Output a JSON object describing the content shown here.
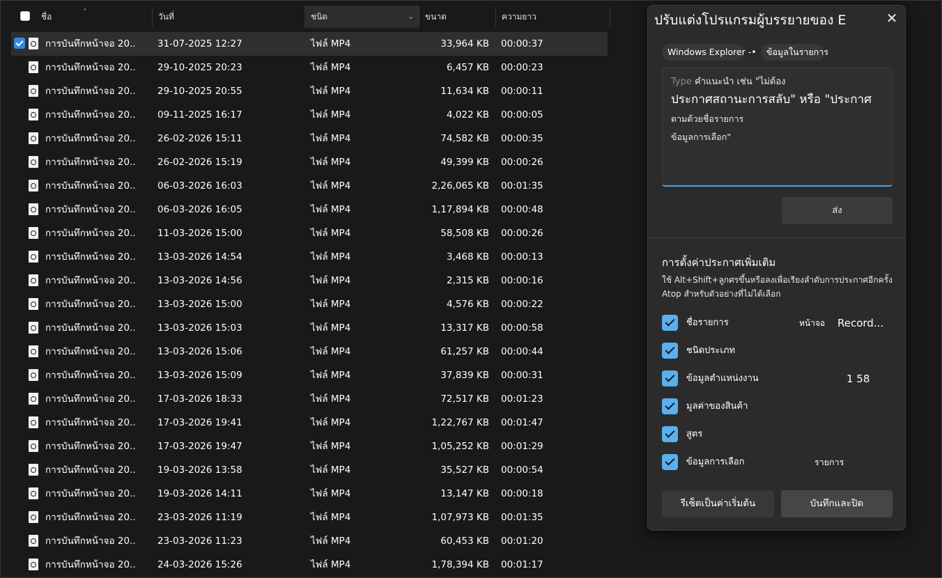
{
  "columns": {
    "name": "ชื่อ",
    "date": "วันที่",
    "type": "ชนิด",
    "size": "ขนาด",
    "length": "ความยาว"
  },
  "icons": {
    "sort_up": "sort-ascending-icon",
    "chevron": "chevron-down-icon",
    "file": "video-file-icon",
    "close": "close-icon"
  },
  "files": [
    {
      "name": "การบันทึกหน้าจอ 20...",
      "date": "31-07-2025 12:27",
      "type": "ไฟล์ MP4",
      "size": "33,964 KB",
      "length": "00:00:37",
      "selected": true
    },
    {
      "name": "การบันทึกหน้าจอ 20...",
      "date": "29-10-2025 20:23",
      "type": "ไฟล์ MP4",
      "size": "6,457 KB",
      "length": "00:00:23"
    },
    {
      "name": "การบันทึกหน้าจอ 20...",
      "date": "29-10-2025 20:55",
      "type": "ไฟล์ MP4",
      "size": "11,634 KB",
      "length": "00:00:11"
    },
    {
      "name": "การบันทึกหน้าจอ 20...",
      "date": "09-11-2025 16:17",
      "type": "ไฟล์ MP4",
      "size": "4,022 KB",
      "length": "00:00:05"
    },
    {
      "name": "การบันทึกหน้าจอ 20...",
      "date": "26-02-2026 15:11",
      "type": "ไฟล์ MP4",
      "size": "74,582 KB",
      "length": "00:00:35"
    },
    {
      "name": "การบันทึกหน้าจอ 20...",
      "date": "26-02-2026 15:19",
      "type": "ไฟล์ MP4",
      "size": "49,399 KB",
      "length": "00:00:26"
    },
    {
      "name": "การบันทึกหน้าจอ 20...",
      "date": "06-03-2026 16:03",
      "type": "ไฟล์ MP4",
      "size": "2,26,065 KB",
      "length": "00:01:35"
    },
    {
      "name": "การบันทึกหน้าจอ 20...",
      "date": "06-03-2026 16:05",
      "type": "ไฟล์ MP4",
      "size": "1,17,894 KB",
      "length": "00:00:48"
    },
    {
      "name": "การบันทึกหน้าจอ 20...",
      "date": "11-03-2026 15:00",
      "type": "ไฟล์ MP4",
      "size": "58,508 KB",
      "length": "00:00:26"
    },
    {
      "name": "การบันทึกหน้าจอ 20...",
      "date": "13-03-2026 14:54",
      "type": "ไฟล์ MP4",
      "size": "3,468 KB",
      "length": "00:00:13"
    },
    {
      "name": "การบันทึกหน้าจอ 20...",
      "date": "13-03-2026 14:56",
      "type": "ไฟล์ MP4",
      "size": "2,315 KB",
      "length": "00:00:16"
    },
    {
      "name": "การบันทึกหน้าจอ 20...",
      "date": "13-03-2026 15:00",
      "type": "ไฟล์ MP4",
      "size": "4,576 KB",
      "length": "00:00:22"
    },
    {
      "name": "การบันทึกหน้าจอ 20...",
      "date": "13-03-2026 15:03",
      "type": "ไฟล์ MP4",
      "size": "13,317 KB",
      "length": "00:00:58"
    },
    {
      "name": "การบันทึกหน้าจอ 20...",
      "date": "13-03-2026 15:06",
      "type": "ไฟล์ MP4",
      "size": "61,257 KB",
      "length": "00:00:44"
    },
    {
      "name": "การบันทึกหน้าจอ 20...",
      "date": "13-03-2026 15:09",
      "type": "ไฟล์ MP4",
      "size": "37,839 KB",
      "length": "00:00:31"
    },
    {
      "name": "การบันทึกหน้าจอ 20...",
      "date": "17-03-2026 18:33",
      "type": "ไฟล์ MP4",
      "size": "72,517 KB",
      "length": "00:01:23"
    },
    {
      "name": "การบันทึกหน้าจอ 20...",
      "date": "17-03-2026 19:41",
      "type": "ไฟล์ MP4",
      "size": "1,22,767 KB",
      "length": "00:01:47"
    },
    {
      "name": "การบันทึกหน้าจอ 20...",
      "date": "17-03-2026 19:47",
      "type": "ไฟล์ MP4",
      "size": "1,05,252 KB",
      "length": "00:01:29"
    },
    {
      "name": "การบันทึกหน้าจอ 20...",
      "date": "19-03-2026 13:58",
      "type": "ไฟล์ MP4",
      "size": "35,527 KB",
      "length": "00:00:54"
    },
    {
      "name": "การบันทึกหน้าจอ 20...",
      "date": "19-03-2026 14:11",
      "type": "ไฟล์ MP4",
      "size": "13,147 KB",
      "length": "00:00:18"
    },
    {
      "name": "การบันทึกหน้าจอ 20...",
      "date": "23-03-2026 11:19",
      "type": "ไฟล์ MP4",
      "size": "1,07,973 KB",
      "length": "00:01:35"
    },
    {
      "name": "การบันทึกหน้าจอ 20...",
      "date": "23-03-2026 11:23",
      "type": "ไฟล์ MP4",
      "size": "60,453 KB",
      "length": "00:01:20"
    },
    {
      "name": "การบันทึกหน้าจอ 20...",
      "date": "24-03-2026 15:26",
      "type": "ไฟล์ MP4",
      "size": "1,78,394 KB",
      "length": "00:01:17"
    }
  ],
  "panel": {
    "title": "ปรับแต่งโปรแกรมผู้บรรยายของ E",
    "chip_app": "Windows Explorer -•",
    "chip_context": "ข้อมูลในรายการ",
    "prompt_line1_placeholder": "Type",
    "prompt_line1_rest": " คำแนะนำ เช่น \"ไม่ต้อง",
    "prompt_line2": "ประกาศสถานะการสลับ\" หรือ \"ประกาศ",
    "prompt_line3": "ตามด้วยชื่อรายการ",
    "prompt_line4": "ข้อมูลการเลือก\"",
    "send_label": "ส่ง",
    "settings_title": "การตั้งค่าประกาศเพิ่มเติม",
    "settings_desc": "ใช้ Alt+Shift+ลูกศรขึ้นหรือลงเพื่อเรียงลำดับการประกาศอีกครั้ง Atop สำหรับตัวอย่างที่ไม่ได้เลือก",
    "options": [
      {
        "label": "ชื่อรายการ",
        "extra1": "หน้าจอ",
        "extra2": "Record...",
        "checked": true
      },
      {
        "label": "ชนิดประเภท",
        "checked": true
      },
      {
        "label": "ข้อมูลตำแหน่งงาน",
        "extra1": "1 58",
        "checked": true
      },
      {
        "label": "มูลค่าของสินค้า",
        "checked": true
      },
      {
        "label": "สูตร",
        "checked": true
      },
      {
        "label": "ข้อมูลการเลือก",
        "extra1": "รายการ",
        "checked": true
      }
    ],
    "reset_label": "รีเซ็ตเป็นค่าเริ่มต้น",
    "save_label": "บันทึกและปิด"
  },
  "colors": {
    "background": "#191919",
    "accent": "#5aafef",
    "selected_row": "#2f2f2f"
  }
}
